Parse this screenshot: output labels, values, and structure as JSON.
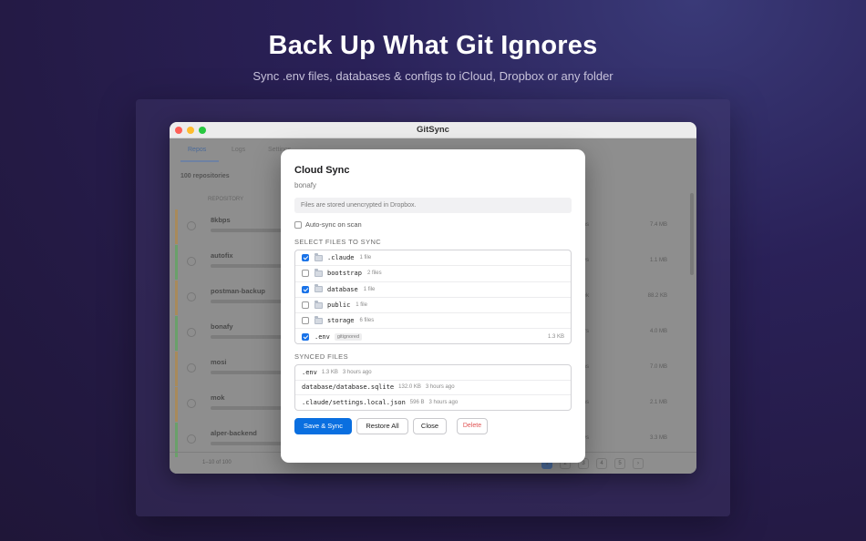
{
  "hero": {
    "title": "Back Up What Git Ignores",
    "subtitle": "Sync .env files, databases & configs to iCloud, Dropbox or any folder"
  },
  "window": {
    "title": "GitSync"
  },
  "background": {
    "tabs": [
      "Repos",
      "Logs",
      "Settings"
    ],
    "repo_count": "100 repositories",
    "column_header": "REPOSITORY",
    "rows": [
      {
        "name": "8kbps",
        "status": "warn",
        "modified": "8 months",
        "right": "7.4 MB"
      },
      {
        "name": "autofix",
        "status": "ok",
        "modified": "2 days",
        "right": "1.1 MB"
      },
      {
        "name": "postman-backup",
        "status": "warn",
        "modified": "1 week",
        "right": "88.2 KB"
      },
      {
        "name": "bonafy",
        "status": "ok",
        "modified": "3 hours",
        "right": "4.0 MB"
      },
      {
        "name": "mosi",
        "status": "warn",
        "modified": "4 months",
        "right": "7.0 MB"
      },
      {
        "name": "mok",
        "status": "warn",
        "modified": "2 months",
        "right": "2.1 MB"
      },
      {
        "name": "alper-backend",
        "status": "ok",
        "modified": "6 days",
        "right": "3.3 MB"
      }
    ],
    "footer_text": "1–10 of 100",
    "pager": [
      "1",
      "2",
      "3",
      "4",
      "5",
      "›"
    ]
  },
  "modal": {
    "title": "Cloud Sync",
    "subtitle": "bonafy",
    "notice": "Files are stored unencrypted in Dropbox.",
    "autosync_label": "Auto-sync on scan",
    "autosync_checked": false,
    "select_label": "SELECT FILES TO SYNC",
    "files": [
      {
        "name": ".claude",
        "meta": "1 file",
        "checked": true,
        "folder": true
      },
      {
        "name": "bootstrap",
        "meta": "2 files",
        "checked": false,
        "folder": true
      },
      {
        "name": "database",
        "meta": "1 file",
        "checked": true,
        "folder": true
      },
      {
        "name": "public",
        "meta": "1 file",
        "checked": false,
        "folder": true
      },
      {
        "name": "storage",
        "meta": "6 files",
        "checked": false,
        "folder": true
      },
      {
        "name": ".env",
        "tag": "gitignored",
        "size": "1.3 KB",
        "checked": true,
        "folder": false
      }
    ],
    "synced_label": "SYNCED FILES",
    "synced": [
      {
        "name": ".env",
        "size": "1.3 KB",
        "time": "3 hours ago"
      },
      {
        "name": "database/database.sqlite",
        "size": "132.0 KB",
        "time": "3 hours ago"
      },
      {
        "name": ".claude/settings.local.json",
        "size": "596 B",
        "time": "3 hours ago"
      }
    ],
    "buttons": {
      "save": "Save & Sync",
      "restore": "Restore All",
      "close": "Close",
      "delete": "Delete"
    }
  },
  "colors": {
    "accent": "#0a6fe0",
    "danger": "#e05252",
    "status_ok": "#6aa06a",
    "status_warn": "#a88a5a"
  }
}
